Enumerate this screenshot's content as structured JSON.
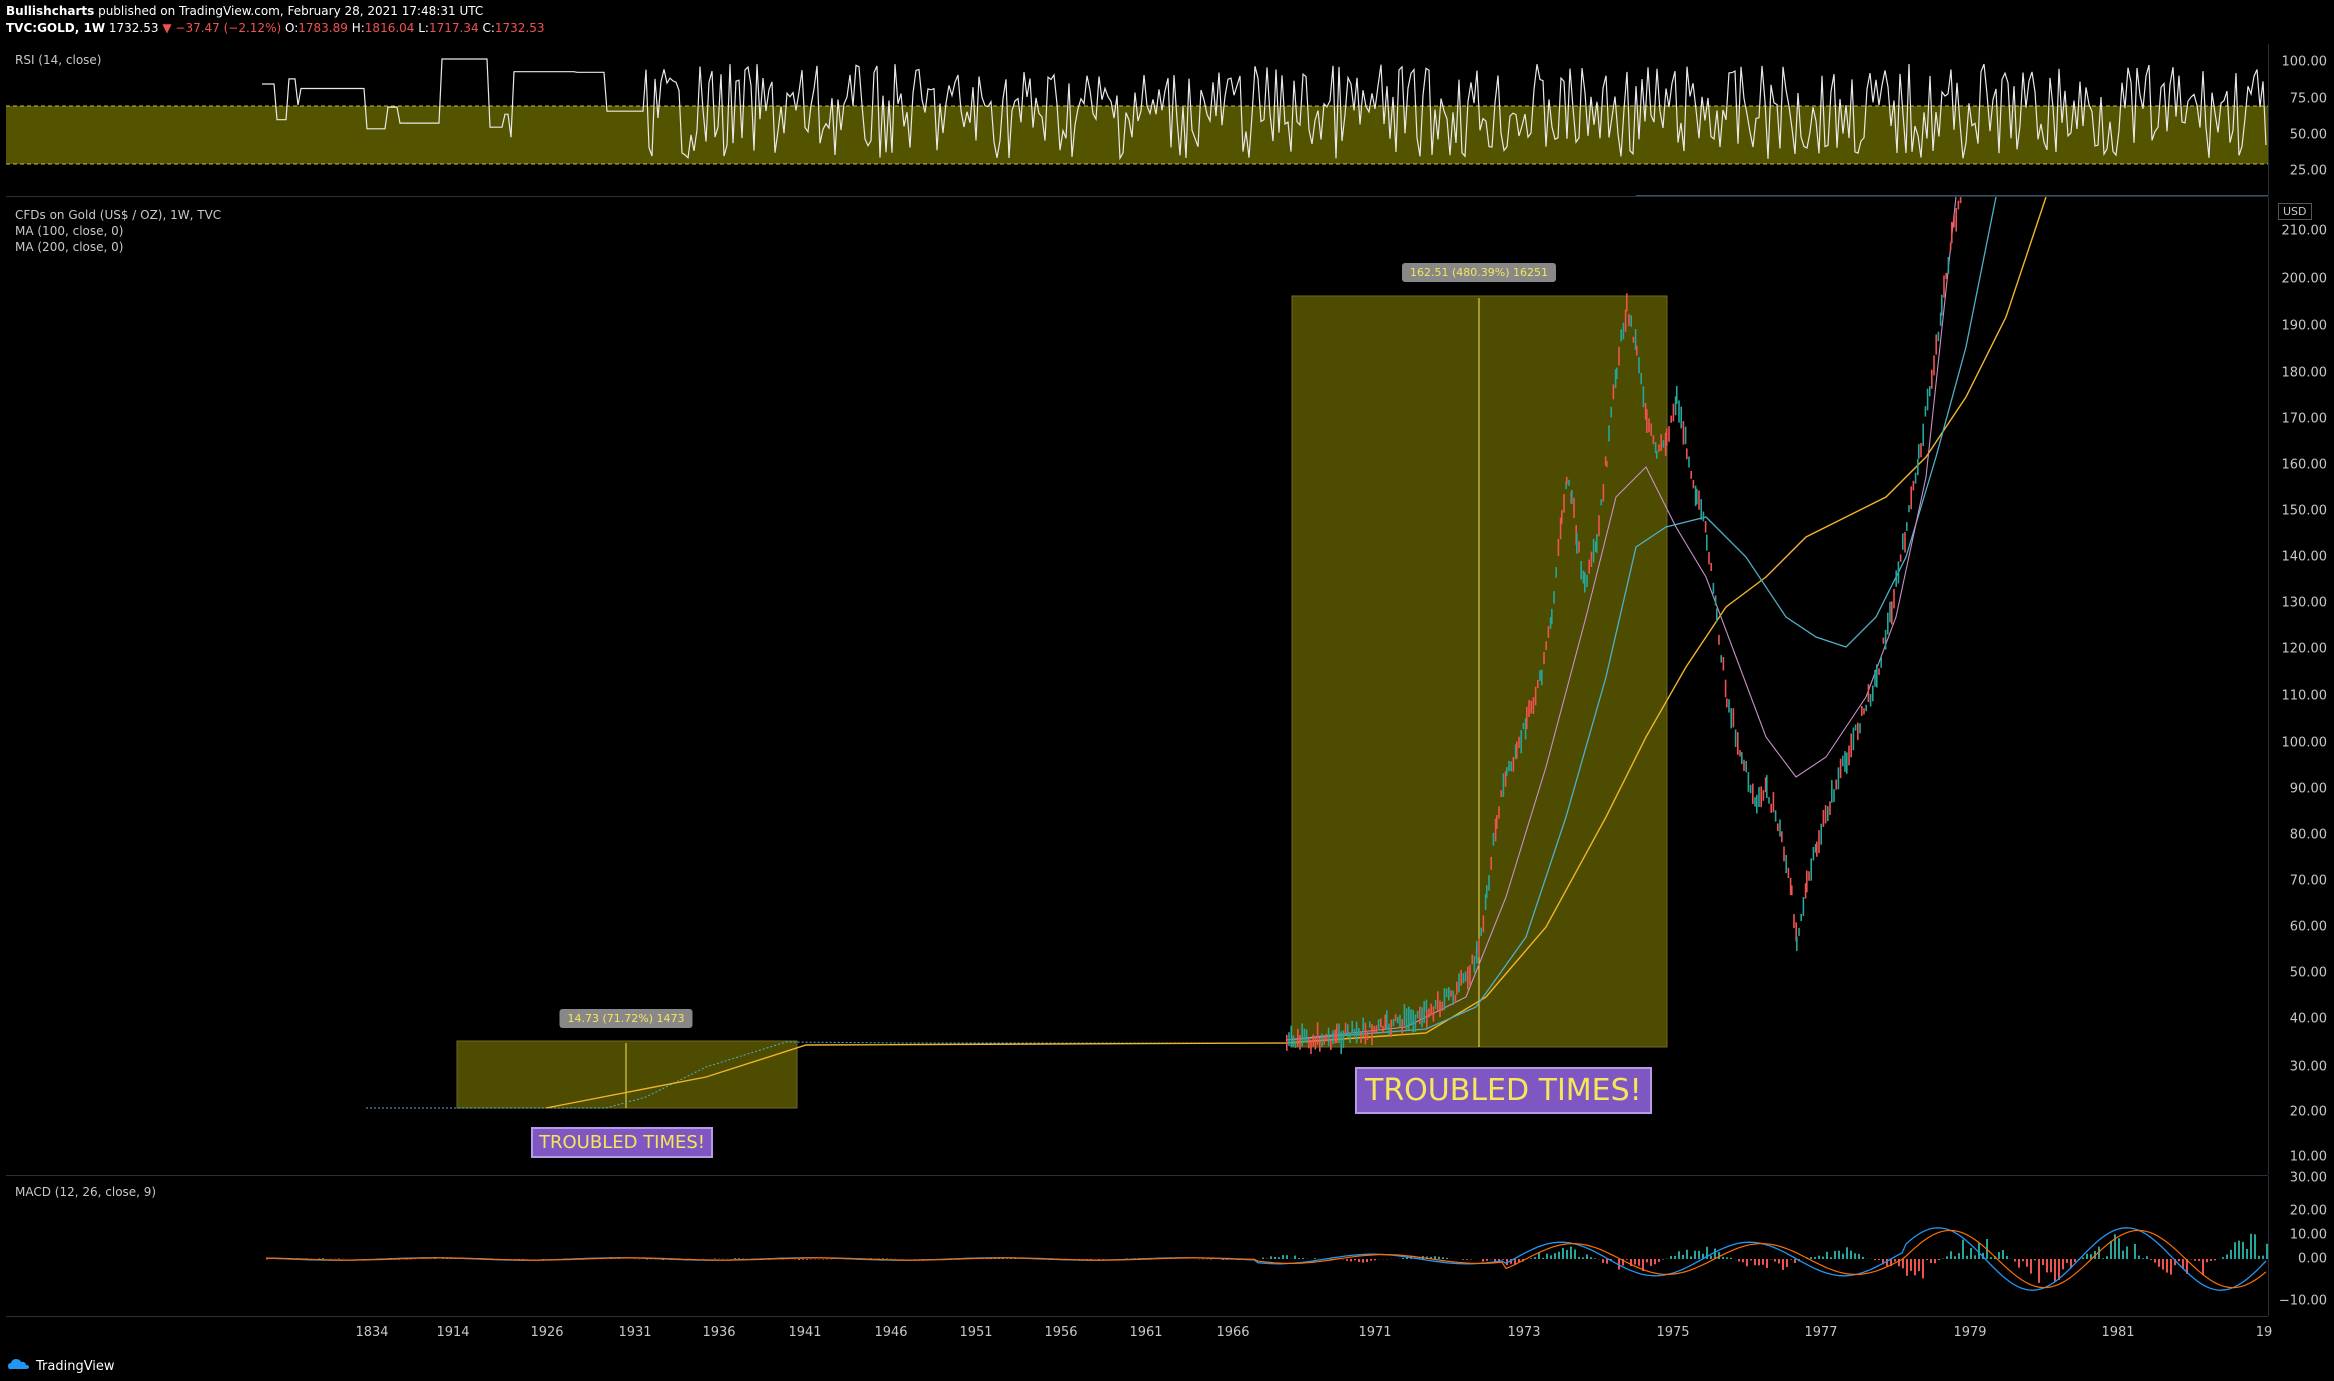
{
  "header": {
    "author": "Bullishcharts",
    "published": " published on TradingView.com, February 28, 2021 17:48:31 UTC",
    "symbol": "TVC:GOLD, 1W",
    "last": "1732.53",
    "change": "▼ −37.47 (−2.12%)",
    "o_label": "O:",
    "o": "1783.89",
    "h_label": "H:",
    "h": "1816.04",
    "l_label": "L:",
    "l": "1717.34",
    "c_label": "C:",
    "c": "1732.53"
  },
  "rsi": {
    "label": "RSI (14, close)",
    "ticks": [
      "100.00",
      "75.00",
      "50.00",
      "25.00"
    ]
  },
  "main": {
    "title": "CFDs on Gold (US$ / OZ), 1W, TVC",
    "ma1": "MA (100, close, 0)",
    "ma2": "MA (200, close, 0)",
    "currency": "USD",
    "ticks": [
      "210.00",
      "200.00",
      "190.00",
      "180.00",
      "170.00",
      "160.00",
      "150.00",
      "140.00",
      "130.00",
      "120.00",
      "110.00",
      "100.00",
      "90.00",
      "80.00",
      "70.00",
      "60.00",
      "50.00",
      "40.00",
      "30.00",
      "20.00",
      "10.00"
    ],
    "measure1": "14.73 (71.72%) 1473",
    "measure2": "162.51 (480.39%) 16251",
    "annotation1": "TROUBLED TIMES!",
    "annotation2": "TROUBLED TIMES!"
  },
  "macd": {
    "label": "MACD (12, 26, close, 9)",
    "ticks": [
      "30.00",
      "20.00",
      "10.00",
      "0.00",
      "−10.00"
    ]
  },
  "time_axis": [
    "1834",
    "1914",
    "1926",
    "1931",
    "1936",
    "1941",
    "1946",
    "1951",
    "1956",
    "1961",
    "1966",
    "1971",
    "1973",
    "1975",
    "1977",
    "1979",
    "1981",
    "19"
  ],
  "footer": {
    "brand": "TradingView"
  },
  "colors": {
    "band": "#807f00",
    "rsi_line": "#e9e9e9",
    "ma100": "#4fb0c6",
    "ma200": "#f0b429",
    "macd_line": "#2196f3",
    "signal_line": "#ff6d00",
    "hist_up": "#26a69a",
    "hist_down": "#ef5350"
  }
}
